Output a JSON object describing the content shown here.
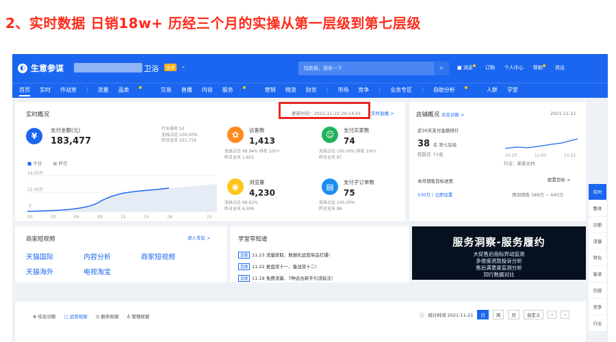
{
  "headline": "2、实时数据 日销18w+ 历经三个月的实操从第一层级到第七层级",
  "app": {
    "logo": "生意参谋",
    "shop_name": "卫浴",
    "shop_badge": "主店",
    "search_placeholder": "找数据，搜索一下",
    "top_links": [
      "消息",
      "订购",
      "个人中心",
      "帮助",
      "退出"
    ]
  },
  "nav": {
    "items": [
      "首页",
      "实时",
      "作战室",
      "流量",
      "品类",
      "交易",
      "直播",
      "内容",
      "服务",
      "营销",
      "物流",
      "财务",
      "市场",
      "竞争",
      "业务专区",
      "自助分析",
      "人群",
      "学堂"
    ]
  },
  "realtime": {
    "title": "实时概况",
    "update_time": "更新时间：2021-11-22 20:14:01",
    "live_link": "实时直播 >",
    "payment_label": "支付金额(元)",
    "payment_value": "183,477",
    "payment_stats": [
      "行业排名 52",
      "无线占比 100.00%",
      "昨日全天 221,719"
    ],
    "legend_today": "今日",
    "legend_yesterday": "昨日",
    "y_ticks": [
      "24.00万",
      "12.00万",
      "0"
    ],
    "x_ticks": [
      "00",
      "03",
      "06",
      "09",
      "12",
      "15",
      "18",
      "23"
    ],
    "visitors_label": "访客数",
    "visitors_value": "1,413",
    "visitors_sub1": "无线占比 98.94%  排名 100+",
    "visitors_sub2": "昨日全天 1,851",
    "buyers_label": "支付买家数",
    "buyers_value": "74",
    "buyers_sub1": "无线占比 100.00%  排名 100+",
    "buyers_sub2": "昨日全天 87",
    "pv_label": "浏览量",
    "pv_value": "4,230",
    "pv_sub1": "无线占比 99.62%",
    "pv_sub2": "昨日全天 6,006",
    "orders_label": "支付子订单数",
    "orders_value": "75",
    "orders_sub1": "无线占比 100.00%",
    "orders_sub2": "昨日全天 88"
  },
  "store": {
    "title": "店铺概况",
    "diag_link": "点击诊断 >",
    "date": "2021-11-21",
    "rank_label": "近30天支付金额排行",
    "rank_value": "38",
    "rank_unit": "名 第七层级",
    "rank_prev": "较前日 ↑2名",
    "industry": "行业：家装主材",
    "spark_x": [
      "10-23",
      "11-05",
      "11-21"
    ],
    "target_label": "本月销售目标进度",
    "target_config": "配置目标 >",
    "target_value": "530万 / 立即设置",
    "forecast": "预测销售 589万 ~ 640万"
  },
  "video": {
    "title": "商家短视频",
    "enter": "进入专区 >",
    "links": [
      "天猫国际",
      "内容分析",
      "商家短视频",
      "天猫海外",
      "电视淘宝"
    ]
  },
  "school": {
    "title": "学堂早知道",
    "tag": "直播",
    "items": [
      "11.23 流量获取、数据化运营单品打爆!",
      "11.22 复盘双十一、备战双十二!",
      "11.19 免费流量、7种适合新手引流玩法!"
    ]
  },
  "banner": {
    "title": "服务洞察-服务履约",
    "lines": [
      "大促售后指标异动监测",
      "多维度退款投诉分析",
      "售后满意度监测分析",
      "同行数据对比"
    ]
  },
  "tabs": [
    "综合诊断",
    "运营视窗",
    "服务视窗",
    "管理视窗"
  ],
  "toolbar": {
    "stat_time": "统计时间 2021-11-21",
    "buttons": [
      "日",
      "周",
      "月",
      "自定义"
    ]
  },
  "side_nav": [
    "实时",
    "整体",
    "诊断",
    "流量",
    "转化",
    "客单",
    "内容",
    "竞争",
    "行业"
  ]
}
